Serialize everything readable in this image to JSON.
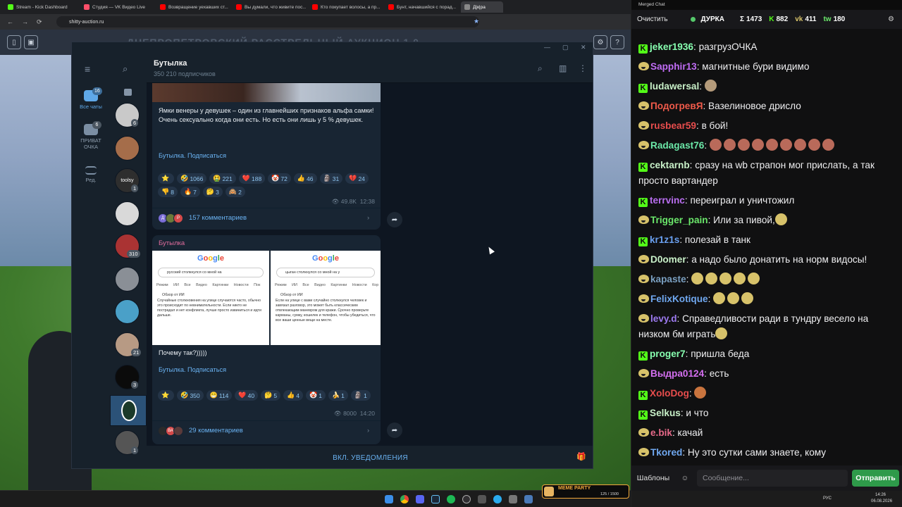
{
  "browser": {
    "tabs": [
      {
        "label": "Stream - Kick Dashboard",
        "color": "#53fc18"
      },
      {
        "label": "Студия — VK Видео Live",
        "color": "#ff4f6a"
      },
      {
        "label": "Возвращение уехавших ст...",
        "color": "#ff0000"
      },
      {
        "label": "Вы думали, что живите пос...",
        "color": "#ff0000"
      },
      {
        "label": "Кто покупает волосы, а пр...",
        "color": "#ff0000"
      },
      {
        "label": "Бунт, начавшийся с порад...",
        "color": "#ff0000"
      },
      {
        "label": "Д|к|ра",
        "color": "#888888"
      }
    ],
    "url": "shitty-auction.ru"
  },
  "site": {
    "title": "ДНЕПРОПЕТРОВСКИЙ РАССТРЕЛЬНЫЙ АУКЦИОН 1.0"
  },
  "telegram": {
    "folders": [
      {
        "label": "Все чаты",
        "badge": "16"
      },
      {
        "label": "ПРИВАТ ОЧКА",
        "badge": "6"
      },
      {
        "label": "Ред.",
        "badge": ""
      }
    ],
    "chats": [
      {
        "count": "6",
        "color": "#c9c9c9"
      },
      {
        "count": "",
        "color": "#a56d4a"
      },
      {
        "count": "1",
        "color": "#2e2e2e",
        "text": "toolsy"
      },
      {
        "count": "",
        "color": "#d9d9d9"
      },
      {
        "count": "310",
        "color": "#a33"
      },
      {
        "count": "",
        "color": "#8a8f96"
      },
      {
        "count": "",
        "color": "#4aa0c8"
      },
      {
        "count": "21",
        "color": "#b79a84"
      },
      {
        "count": "3",
        "color": "#0b0b0b"
      },
      {
        "count": "",
        "color": "#1b3a2a"
      },
      {
        "count": "1",
        "color": "#555"
      }
    ],
    "channel": {
      "title": "Бутылка",
      "subscribers": "350 210 подписчиков"
    },
    "post1": {
      "text": "Ямки венеры у девушек – один из главнейших признаков альфа самки!\nОчень сексуально когда они есть. Но есть они лишь у 5 % девушек.",
      "link": "Бутылка. Подписаться",
      "reactions": [
        {
          "e": "⭐",
          "n": ""
        },
        {
          "e": "🤣",
          "n": "1066"
        },
        {
          "e": "🤮",
          "n": "221"
        },
        {
          "e": "❤️",
          "n": "188"
        },
        {
          "e": "🤡",
          "n": "72"
        },
        {
          "e": "👍",
          "n": "46"
        },
        {
          "e": "🗿",
          "n": "31"
        },
        {
          "e": "💔",
          "n": "24"
        },
        {
          "e": "👎",
          "n": "8"
        },
        {
          "e": "🔥",
          "n": "7"
        },
        {
          "e": "🤔",
          "n": "3"
        },
        {
          "e": "🙈",
          "n": "2"
        }
      ],
      "views": "49.8K",
      "time": "12:38",
      "comments": "157 комментариев"
    },
    "post2": {
      "author": "Бутылка",
      "img1": {
        "search": "русский столкнулся со мной на",
        "tabs": "Режим ИИ  Все  Видео  Картинки  Новости  Пок",
        "ai": "Обзор от ИИ",
        "text": "Случайные столкновения на улице случаются часто, обычно это происходит по невнимательности. Если никто не пострадал и нет конфликта, лучше просто извиниться и идти дальше."
      },
      "img2": {
        "search": "цыган столкнулся со мной на у",
        "tabs": "Режим ИИ  Все  Видео  Картинки  Новости  Кор",
        "ai": "Обзор от ИИ",
        "text": "Если на улице с вами случайно столкнулся человек и завязал разговор, это может быть классическим отвлекающим маневром для кражи. Срочно проверьте карманы, сумку, кошелек и телефон, чтобы убедиться, что все ваши ценные вещи на месте."
      },
      "text": "Почему так?)))))",
      "link": "Бутылка. Подписаться",
      "reactions": [
        {
          "e": "⭐",
          "n": ""
        },
        {
          "e": "🤣",
          "n": "350"
        },
        {
          "e": "😁",
          "n": "114"
        },
        {
          "e": "❤️",
          "n": "40"
        },
        {
          "e": "🤔",
          "n": "5"
        },
        {
          "e": "👍",
          "n": "4"
        },
        {
          "e": "🤡",
          "n": "1"
        },
        {
          "e": "🍌",
          "n": "1"
        },
        {
          "e": "🗿",
          "n": "1"
        }
      ],
      "views": "8000",
      "time": "14:20",
      "comments": "29 комментариев"
    },
    "bottom": "ВКЛ. УВЕДОМЛЕНИЯ"
  },
  "chat": {
    "window_title": "Merged Chat",
    "clear": "Очистить",
    "channel": "ДУРКА",
    "stats": [
      {
        "icon": "Σ",
        "value": "1473"
      },
      {
        "icon": "K",
        "value": "882"
      },
      {
        "icon": "vk",
        "value": "411"
      },
      {
        "icon": "tw",
        "value": "180"
      }
    ],
    "messages": [
      {
        "p": "kick",
        "user": "jeker1936",
        "color": "#87ffb0",
        "text": "разгрузОЧКА"
      },
      {
        "p": "vk",
        "user": "Sapphir13",
        "color": "#c06cf5",
        "text": "магнитные бури видимо"
      },
      {
        "p": "kick",
        "user": "ludawersal",
        "color": "#c8f0c8",
        "text": "",
        "emotes": 1,
        "ecolor": "#b49a7a"
      },
      {
        "p": "vk",
        "user": "ПодогревЯ",
        "color": "#f05a4a",
        "text": "Вазелиновое дрисло"
      },
      {
        "p": "vk",
        "user": "rusbear59",
        "color": "#e84d4d",
        "text": "в бой!"
      },
      {
        "p": "vk",
        "user": "Radagast76",
        "color": "#6be8a8",
        "text": "",
        "emotes": 9,
        "ecolor": "#b96a5a"
      },
      {
        "p": "kick",
        "user": "cektarnb",
        "color": "#c8f0c8",
        "text": "сразу на wb страпон мог прислать, а так просто вартандер"
      },
      {
        "p": "kick",
        "user": "terrvinc",
        "color": "#b96ef0",
        "text": "переиграл и уничтожил"
      },
      {
        "p": "vk",
        "user": "Trigger_pain",
        "color": "#6be86b",
        "text": "Или за пивой,",
        "emotes": 1,
        "ecolor": "#d7c26a"
      },
      {
        "p": "kick",
        "user": "kr1z1s",
        "color": "#6aa0f0",
        "text": "полезай в танк"
      },
      {
        "p": "vk",
        "user": "D0omer",
        "color": "#c8f0c8",
        "text": "а надо было донатить на норм видосы!"
      },
      {
        "p": "vk",
        "user": "kapaste",
        "color": "#7a9fc0",
        "text": "",
        "emotes": 5,
        "ecolor": "#d7c26a"
      },
      {
        "p": "vk",
        "user": "FelixKotique",
        "color": "#70a8f0",
        "text": "",
        "emotes": 3,
        "ecolor": "#d7c26a"
      },
      {
        "p": "vk",
        "user": "levy.d",
        "color": "#9d7af0",
        "text": "Справедливости ради в тундру весело на низком бм играть",
        "emotes": 1,
        "ecolor": "#d7c26a"
      },
      {
        "p": "kick",
        "user": "proger7",
        "color": "#87ffb0",
        "text": "пришла беда"
      },
      {
        "p": "vk",
        "user": "Выдра0124",
        "color": "#d46ff0",
        "text": "есть"
      },
      {
        "p": "kick",
        "user": "XoloDog",
        "color": "#e84d4d",
        "text": "",
        "emotes": 1,
        "ecolor": "#c9743e"
      },
      {
        "p": "kick",
        "user": "Selkus",
        "color": "#c8f0c8",
        "text": "и что"
      },
      {
        "p": "vk",
        "user": "e.bik",
        "color": "#e86a8a",
        "text": "качай"
      },
      {
        "p": "vk",
        "user": "Tkored",
        "color": "#70a8f0",
        "text": "Ну это сутки сами знаете, кому"
      }
    ],
    "templates": "Шаблоны",
    "placeholder": "Сообщение...",
    "send": "Отправить"
  },
  "taskbar": {
    "lang": "РУС",
    "time": "14:26",
    "date": "06.08.2026",
    "overlay": "MEME PARTY",
    "overlay_count": "125 / 1500"
  }
}
